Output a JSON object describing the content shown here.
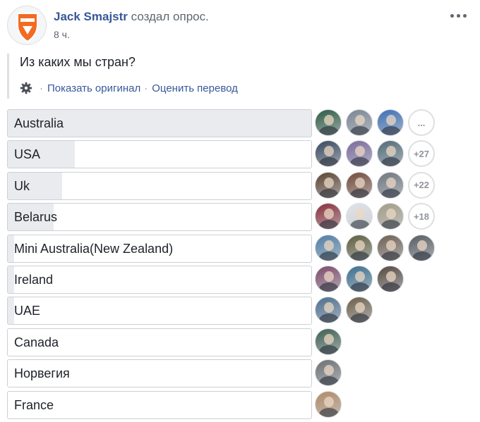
{
  "post": {
    "author": "Jack Smajstr",
    "action": "создал опрос.",
    "time": "8 ч.",
    "question": "Из каких мы стран?",
    "translate": {
      "icon": "gear-icon",
      "show_original": "Показать оригинал",
      "separator": "·",
      "rate_translation": "Оценить перевод"
    }
  },
  "poll": {
    "options": [
      {
        "label": "Australia",
        "fill_fraction": 1.0,
        "voters": [
          "#2c5b43",
          "#7a8594",
          "#3c6fb5"
        ],
        "more": "..."
      },
      {
        "label": "USA",
        "fill_fraction": 0.22,
        "voters": [
          "#38485d",
          "#7a6a9e",
          "#506b78"
        ],
        "more": "+27"
      },
      {
        "label": "Uk",
        "fill_fraction": 0.18,
        "voters": [
          "#5b4330",
          "#744a3a",
          "#6f767e"
        ],
        "more": "+22"
      },
      {
        "label": "Belarus",
        "fill_fraction": 0.15,
        "voters": [
          "#8a2f3a",
          "#dfe3e8",
          "#a39c87"
        ],
        "more": "+18"
      },
      {
        "label": "Mini Australia(New Zealand)",
        "fill_fraction": 0.02,
        "voters": [
          "#4f7ea6",
          "#5e5d3f",
          "#6e5f52",
          "#575c62"
        ],
        "more": ""
      },
      {
        "label": "Ireland",
        "fill_fraction": 0.02,
        "voters": [
          "#7d4a6a",
          "#3b6f8e",
          "#54483f"
        ],
        "more": ""
      },
      {
        "label": "UAE",
        "fill_fraction": 0.02,
        "voters": [
          "#4c6e8e",
          "#6c5f4a"
        ],
        "more": ""
      },
      {
        "label": "Canada",
        "fill_fraction": 0.0,
        "voters": [
          "#3f5f4f"
        ],
        "more": ""
      },
      {
        "label": "Норвегия",
        "fill_fraction": 0.0,
        "voters": [
          "#6b7075"
        ],
        "more": ""
      },
      {
        "label": "France",
        "fill_fraction": 0.0,
        "voters": [
          "#b08a66"
        ],
        "more": ""
      }
    ]
  },
  "colors": {
    "author_link": "#365899",
    "link": "#385898",
    "fill": "#e9ebee",
    "logo": "#f26b21"
  }
}
